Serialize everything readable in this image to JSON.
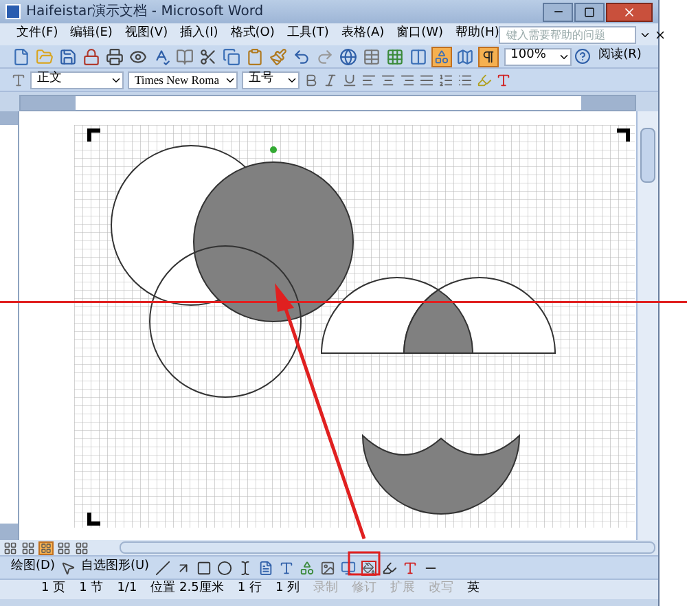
{
  "window": {
    "title": "Haifeistar演示文档 - Microsoft Word"
  },
  "menu": [
    {
      "label": "文件(F)"
    },
    {
      "label": "编辑(E)"
    },
    {
      "label": "视图(V)"
    },
    {
      "label": "插入(I)"
    },
    {
      "label": "格式(O)"
    },
    {
      "label": "工具(T)"
    },
    {
      "label": "表格(A)"
    },
    {
      "label": "窗口(W)"
    },
    {
      "label": "帮助(H)"
    }
  ],
  "help_box": {
    "placeholder": "键入需要帮助的问题"
  },
  "standard_toolbar": {
    "buttons": [
      {
        "kind": "new",
        "pressed": false
      },
      {
        "kind": "open",
        "pressed": false
      },
      {
        "kind": "save",
        "pressed": false
      },
      {
        "kind": "permission",
        "pressed": false
      },
      {
        "kind": "print",
        "pressed": false
      },
      {
        "kind": "preview",
        "pressed": false
      },
      {
        "kind": "spell",
        "pressed": false
      },
      {
        "kind": "research",
        "pressed": false
      },
      {
        "kind": "cut",
        "pressed": false
      },
      {
        "kind": "copy",
        "pressed": false
      },
      {
        "kind": "paste",
        "pressed": false
      },
      {
        "kind": "format-painter",
        "pressed": false
      },
      {
        "kind": "undo",
        "pressed": false
      },
      {
        "kind": "redo",
        "pressed": false
      },
      {
        "kind": "link",
        "pressed": false
      },
      {
        "kind": "table",
        "pressed": false
      },
      {
        "kind": "excel",
        "pressed": false
      },
      {
        "kind": "columns",
        "pressed": false
      },
      {
        "kind": "drawing",
        "pressed": true
      },
      {
        "kind": "map",
        "pressed": false
      },
      {
        "kind": "marks",
        "pressed": true
      }
    ],
    "zoom": "100%",
    "read_button": "阅读(R)"
  },
  "formatting_toolbar": {
    "style": "正文",
    "font": "Times New Roma",
    "size": "五号"
  },
  "view_buttons": [
    {
      "selected": false
    },
    {
      "selected": false
    },
    {
      "selected": true
    },
    {
      "selected": false
    },
    {
      "selected": false
    }
  ],
  "drawing_toolbar": {
    "draw_menu": "绘图(D)",
    "autoshapes_menu": "自选图形(U)"
  },
  "status_bar": [
    {
      "text": "1 页",
      "disabled": false
    },
    {
      "text": "1 节",
      "disabled": false
    },
    {
      "text": "1/1",
      "disabled": false
    },
    {
      "text": "位置 2.5厘米",
      "disabled": false
    },
    {
      "text": "1 行",
      "disabled": false
    },
    {
      "text": "1 列",
      "disabled": false
    },
    {
      "text": "录制",
      "disabled": true
    },
    {
      "text": "修订",
      "disabled": true
    },
    {
      "text": "扩展",
      "disabled": true
    },
    {
      "text": "改写",
      "disabled": true
    },
    {
      "text": "英",
      "disabled": false
    }
  ]
}
